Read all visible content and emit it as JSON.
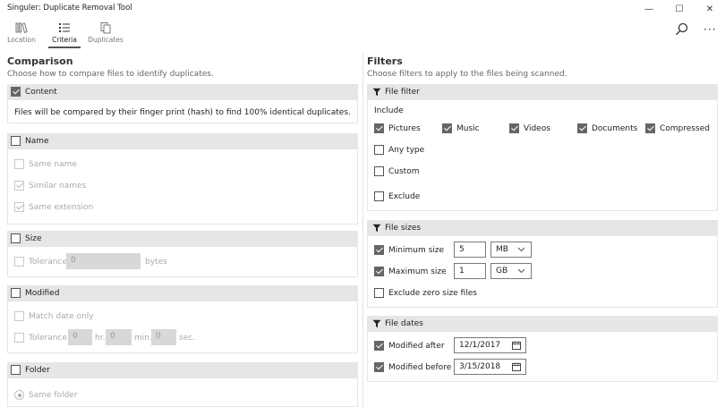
{
  "window": {
    "title": "Singuler: Duplicate Removal Tool",
    "minimize": "—",
    "maximize": "☐",
    "close": "✕"
  },
  "tabs": [
    {
      "label": "Location"
    },
    {
      "label": "Criteria"
    },
    {
      "label": "Duplicates"
    }
  ],
  "actions": {
    "more": "···"
  },
  "comparison": {
    "title": "Comparison",
    "subtitle": "Choose how to compare files to identify duplicates.",
    "content": {
      "label": "Content",
      "checked": true,
      "description": "Files will be compared by their finger print (hash) to find 100% identical duplicates."
    },
    "name": {
      "label": "Name",
      "checked": false,
      "options": [
        {
          "label": "Same name",
          "checked": false
        },
        {
          "label": "Similar names",
          "checked": true
        },
        {
          "label": "Same extension",
          "checked": true
        }
      ]
    },
    "size": {
      "label": "Size",
      "checked": false,
      "tolerance_label": "Tolerance",
      "tolerance_value": "0",
      "unit": "bytes"
    },
    "modified": {
      "label": "Modified",
      "checked": false,
      "match_date_only": "Match date only",
      "tolerance_label": "Tolerance",
      "hr_value": "0",
      "hr_unit": "hr.",
      "min_value": "0",
      "min_unit": "min.",
      "sec_value": "0",
      "sec_unit": "sec."
    },
    "folder": {
      "label": "Folder",
      "checked": false,
      "same_folder": "Same folder"
    }
  },
  "filters": {
    "title": "Filters",
    "subtitle": "Choose filters to apply to the files being scanned.",
    "file_filter": {
      "label": "File filter",
      "include_label": "Include",
      "types": [
        {
          "label": "Pictures",
          "checked": true
        },
        {
          "label": "Music",
          "checked": true
        },
        {
          "label": "Videos",
          "checked": true
        },
        {
          "label": "Documents",
          "checked": true
        },
        {
          "label": "Compressed",
          "checked": true
        }
      ],
      "any_type": "Any type",
      "custom": "Custom",
      "exclude": "Exclude"
    },
    "file_sizes": {
      "label": "File sizes",
      "minimum_label": "Minimum size",
      "minimum_value": "5",
      "minimum_unit": "MB",
      "maximum_label": "Maximum size",
      "maximum_value": "1",
      "maximum_unit": "GB",
      "exclude_zero": "Exclude zero size files"
    },
    "file_dates": {
      "label": "File dates",
      "after_label": "Modified after",
      "after_value": "12/1/2017",
      "before_label": "Modified before",
      "before_value": "3/15/2018"
    }
  }
}
